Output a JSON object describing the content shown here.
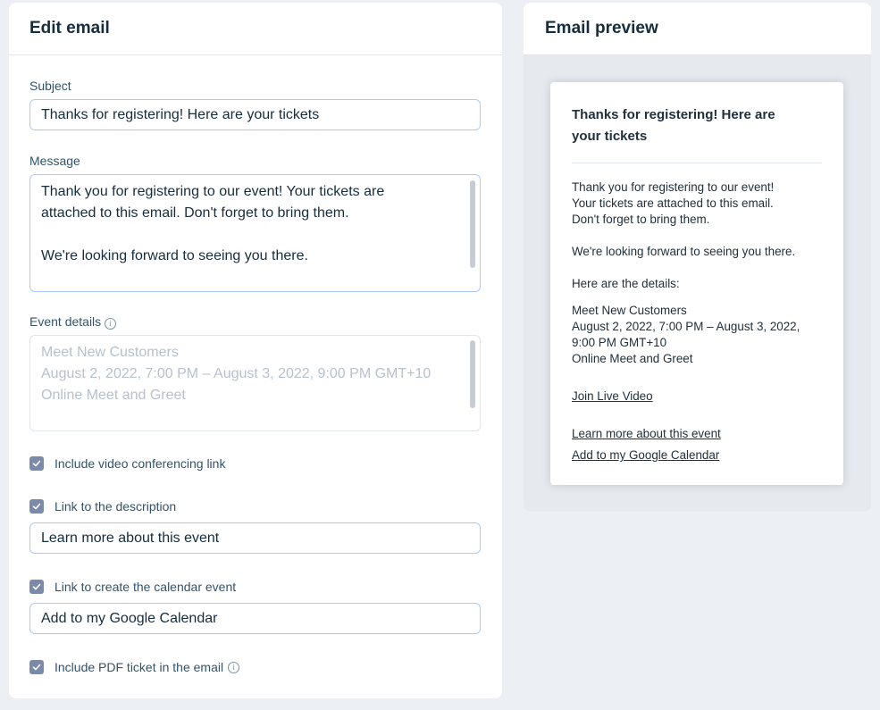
{
  "edit": {
    "title": "Edit email",
    "subject_label": "Subject",
    "subject_value": "Thanks for registering! Here are your tickets",
    "message_label": "Message",
    "message_lines": [
      "Thank you for registering to our event! Your tickets are",
      "attached to this email. Don't forget to bring them.",
      "We're looking forward to seeing you there."
    ],
    "event_details_label": "Event details",
    "event_details_lines": [
      "Meet New Customers",
      "August 2, 2022, 7:00 PM – August 3, 2022, 9:00 PM GMT+10",
      "Online Meet and Greet"
    ],
    "info_glyph": "i",
    "video_label": "Include video conferencing link",
    "description_link_label": "Link to the description",
    "description_link_value": "Learn more about this event",
    "calendar_link_label": "Link to create the calendar event",
    "calendar_link_value": "Add to my Google Calendar",
    "pdf_label": "Include PDF ticket in the email",
    "checkboxes": {
      "video": true,
      "description": true,
      "calendar": true,
      "pdf": true
    }
  },
  "preview": {
    "title": "Email preview",
    "subject_lines": [
      "Thanks for registering! Here are",
      "your tickets"
    ],
    "body_lines": [
      "Thank you for registering to our event!",
      "Your tickets are attached to this email.",
      "Don't forget to bring them."
    ],
    "looking_forward": "We're looking forward to seeing you there.",
    "details_intro": "Here are the details:",
    "details_lines": [
      "Meet New Customers",
      "August 2, 2022, 7:00 PM – August 3, 2022,",
      "9:00 PM GMT+10",
      "Online Meet and Greet"
    ],
    "join_video": "Join Live Video",
    "learn_more": "Learn more about this event",
    "add_calendar": "Add to my Google Calendar"
  },
  "colors": {
    "background": "#eceff3",
    "input_border": "#a8caff",
    "checkbox": "#7a8aa8",
    "heading": "#162d3d"
  },
  "icons": [
    "info-icon",
    "checkmark-icon"
  ]
}
